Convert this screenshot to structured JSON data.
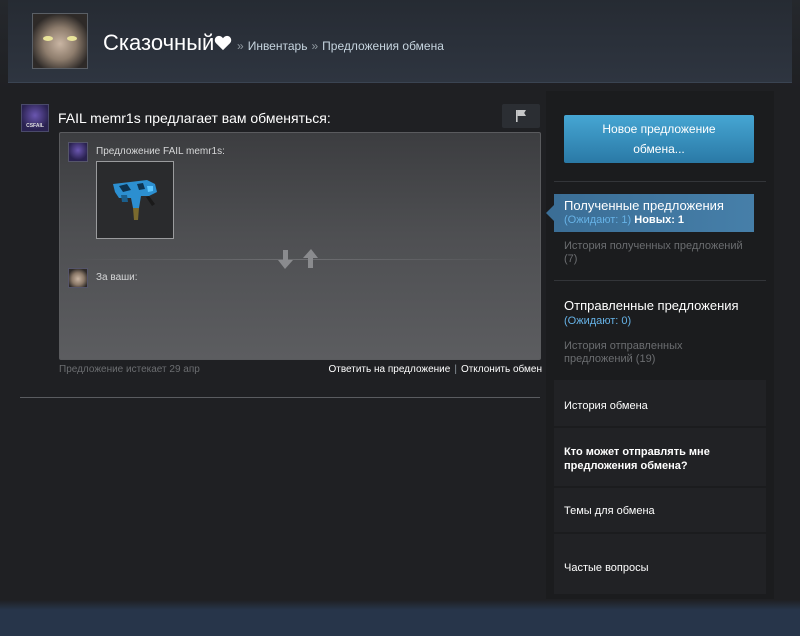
{
  "header": {
    "username": "Сказочный",
    "breadcrumb_sep": "»",
    "breadcrumbs": [
      "Инвентарь",
      "Предложения обмена"
    ]
  },
  "offer": {
    "partner_icon_text": "CSFAIL",
    "title_name": "FAIL memr1s",
    "title_rest": " предлагает вам обменяться:",
    "their_label": "Предложение FAIL memr1s:",
    "your_label": "За ваши:",
    "expires": "Предложение истекает 29 апр",
    "respond_link": "Ответить на предложение",
    "action_sep": "|",
    "decline_link": "Отклонить обмен"
  },
  "sidebar": {
    "new_offer_button": "Новое предложение обмена...",
    "received": {
      "title": "Полученные предложения",
      "waiting": "(Ожидают: 1)",
      "new_label": "Новых: 1"
    },
    "received_history": "История полученных предложений (7)",
    "sent": {
      "title": "Отправленные предложения",
      "waiting": "(Ожидают: 0)"
    },
    "sent_history": "История отправленных предложений (19)",
    "trade_history": "История обмена",
    "who_can_send": "Кто может отправлять мне предложения обмена?",
    "trade_topics": "Темы для обмена",
    "faq": "Частые вопросы"
  },
  "colors": {
    "accent_blue": "#4c94c4",
    "highlight_blue": "#66b2e6",
    "background": "#1f2023"
  },
  "icons": [
    "heart-icon",
    "flag-icon",
    "arrow-down-icon",
    "arrow-up-icon",
    "smg-item-icon"
  ]
}
